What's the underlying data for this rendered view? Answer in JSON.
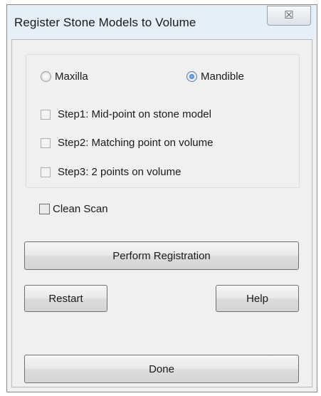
{
  "dialog": {
    "title": "Register Stone Models to Volume",
    "close_label": "☒"
  },
  "jaw": {
    "options": [
      {
        "label": "Maxilla",
        "selected": false
      },
      {
        "label": "Mandible",
        "selected": true
      }
    ]
  },
  "steps": [
    {
      "label": "Step1: Mid-point on stone model",
      "checked": false
    },
    {
      "label": "Step2: Matching point on volume",
      "checked": false
    },
    {
      "label": "Step3: 2 points on volume",
      "checked": false
    }
  ],
  "clean_scan": {
    "label": "Clean Scan",
    "checked": false
  },
  "buttons": {
    "perform_registration": "Perform Registration",
    "restart": "Restart",
    "help": "Help",
    "done": "Done"
  }
}
